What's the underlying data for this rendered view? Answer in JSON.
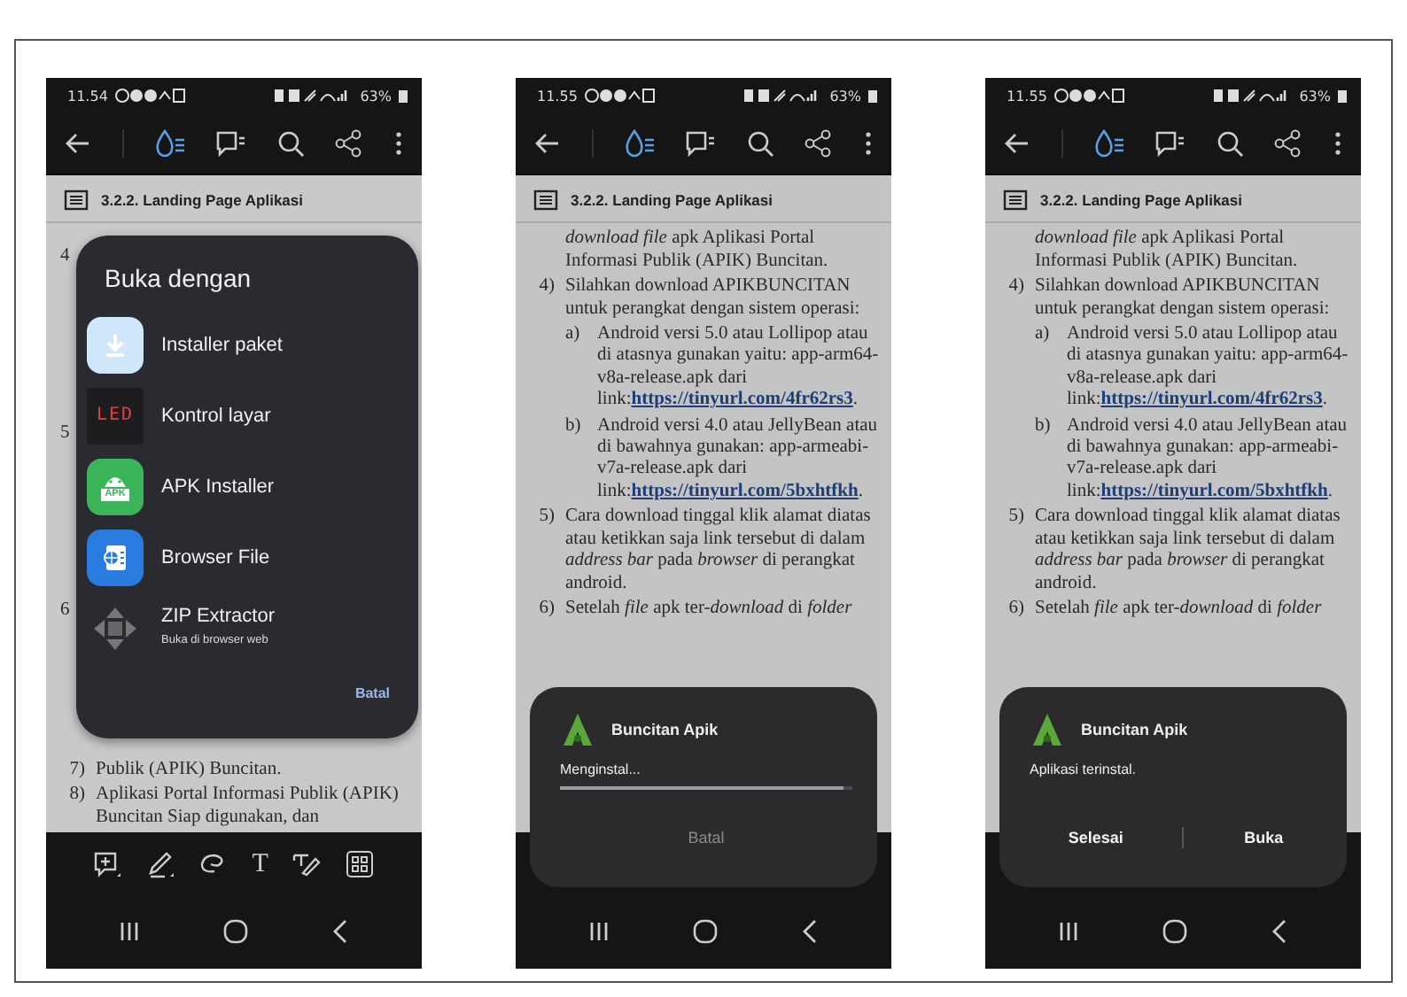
{
  "figure": {
    "phones": [
      {
        "status": {
          "time": "11.54",
          "battery": "63%"
        },
        "doc": {
          "heading": "3.2.2. Landing Page Aplikasi",
          "blocks": [
            {
              "kind": "mark",
              "marker": "4"
            },
            {
              "kind": "mark",
              "marker": "5"
            },
            {
              "kind": "mark",
              "marker": "6"
            },
            {
              "kind": "item",
              "marker": "7)",
              "text": "Publik (APIK) Buncitan."
            },
            {
              "kind": "item",
              "marker": "8)",
              "text": "Aplikasi Portal Informasi Publik (APIK) Buncitan Siap digunakan, dan"
            }
          ]
        },
        "annotation_toolbar": {
          "text_tool": "T"
        },
        "overlay": {
          "kind": "chooser",
          "title": "Buka dengan",
          "apps": [
            {
              "kind": "download",
              "name": "Installer paket"
            },
            {
              "kind": "led",
              "icon_label": "LED",
              "name": "Kontrol layar"
            },
            {
              "kind": "apk",
              "icon_label": "APK",
              "name": "APK Installer"
            },
            {
              "kind": "browser",
              "name": "Browser File"
            },
            {
              "kind": "move",
              "name": "ZIP Extractor",
              "subtitle": "Buka di browser web"
            }
          ],
          "cancel": "Batal"
        }
      },
      {
        "status": {
          "time": "11.55",
          "battery": "63%"
        },
        "doc": {
          "heading": "3.2.2. Landing Page Aplikasi",
          "blocks": [
            {
              "kind": "cont",
              "text": "*download file* apk Aplikasi Portal Informasi Publik (APIK) Buncitan."
            },
            {
              "kind": "item",
              "marker": "4)",
              "text": "Silahkan download APIKBUNCITAN untuk perangkat dengan sistem operasi:"
            },
            {
              "kind": "sub",
              "marker": "a)",
              "text": "Android versi 5.0 atau Lollipop atau di atasnya gunakan yaitu: app-arm64-v8a-release.apk dari link:",
              "link": "https://tinyurl.com/4fr62rs3",
              "after": "."
            },
            {
              "kind": "sub",
              "marker": "b)",
              "text": "Android versi 4.0 atau JellyBean atau di bawahnya gunakan: app-armeabi-v7a-release.apk dari link:",
              "link": "https://tinyurl.com/5bxhtfkh",
              "after": "."
            },
            {
              "kind": "item",
              "marker": "5)",
              "text": "Cara download tinggal klik alamat diatas atau ketikkan saja link tersebut di dalam *address bar* pada *browser* di perangkat android."
            },
            {
              "kind": "item",
              "marker": "6)",
              "text": "Setelah *file* apk ter-*download* di *folder*"
            }
          ]
        },
        "overlay": {
          "kind": "installer",
          "app_name": "Buncitan Apik",
          "status": "Menginstal...",
          "progress": {
            "level": 0.97
          },
          "buttons": [
            {
              "label": "Batal",
              "disabled": true
            }
          ]
        }
      },
      {
        "status": {
          "time": "11.55",
          "battery": "63%"
        },
        "doc": {
          "heading": "3.2.2. Landing Page Aplikasi",
          "blocks": [
            {
              "kind": "cont",
              "text": "*download file* apk Aplikasi Portal Informasi Publik (APIK) Buncitan."
            },
            {
              "kind": "item",
              "marker": "4)",
              "text": "Silahkan download APIKBUNCITAN untuk perangkat dengan sistem operasi:"
            },
            {
              "kind": "sub",
              "marker": "a)",
              "text": "Android versi 5.0 atau Lollipop atau di atasnya gunakan yaitu: app-arm64-v8a-release.apk dari link:",
              "link": "https://tinyurl.com/4fr62rs3",
              "after": "."
            },
            {
              "kind": "sub",
              "marker": "b)",
              "text": "Android versi 4.0 atau JellyBean atau di bawahnya gunakan: app-armeabi-v7a-release.apk dari link:",
              "link": "https://tinyurl.com/5bxhtfkh",
              "after": "."
            },
            {
              "kind": "item",
              "marker": "5)",
              "text": "Cara download tinggal klik alamat diatas atau ketikkan saja link tersebut di dalam *address bar* pada *browser* di perangkat android."
            },
            {
              "kind": "item",
              "marker": "6)",
              "text": "Setelah *file* apk ter-*download* di *folder*"
            }
          ]
        },
        "overlay": {
          "kind": "installer",
          "app_name": "Buncitan Apik",
          "status": "Aplikasi terinstal.",
          "buttons": [
            {
              "label": "Selesai",
              "disabled": false
            },
            {
              "label": "Buka",
              "disabled": false
            }
          ]
        }
      }
    ]
  }
}
